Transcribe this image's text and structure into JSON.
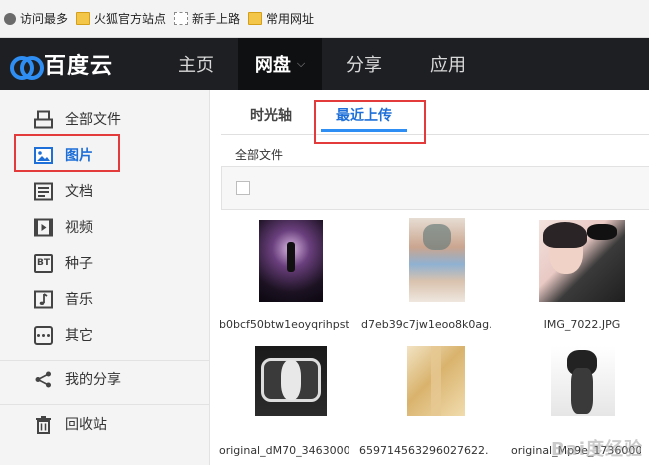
{
  "bookmarks": [
    {
      "label": "访问最多",
      "icon": "gear-icon"
    },
    {
      "label": "火狐官方站点",
      "icon": "folder-icon"
    },
    {
      "label": "新手上路",
      "icon": "page-icon"
    },
    {
      "label": "常用网址",
      "icon": "folder-icon"
    }
  ],
  "app": {
    "name": "百度云"
  },
  "nav": [
    {
      "label": "主页"
    },
    {
      "label": "网盘"
    },
    {
      "label": "分享"
    },
    {
      "label": "应用"
    }
  ],
  "sidebar": {
    "items": [
      {
        "label": "全部文件",
        "icon": "printer-icon"
      },
      {
        "label": "图片",
        "icon": "picture-icon"
      },
      {
        "label": "文档",
        "icon": "document-icon"
      },
      {
        "label": "视频",
        "icon": "video-icon"
      },
      {
        "label": "种子",
        "icon": "bt-icon"
      },
      {
        "label": "音乐",
        "icon": "music-icon"
      },
      {
        "label": "其它",
        "icon": "more-icon"
      },
      {
        "label": "我的分享",
        "icon": "share-icon"
      },
      {
        "label": "回收站",
        "icon": "trash-icon"
      }
    ],
    "active_index": 1
  },
  "main": {
    "tabs": [
      {
        "label": "时光轴"
      },
      {
        "label": "最近上传"
      }
    ],
    "active_tab": 1,
    "breadcrumb": "全部文件",
    "files": [
      {
        "name": "b0bcf50btw1eoyqrihpst..."
      },
      {
        "name": "d7eb39c7jw1eoo8k0ag..."
      },
      {
        "name": "IMG_7022.JPG"
      },
      {
        "name": "original_dM70_3463000..."
      },
      {
        "name": "659714563296027622..."
      },
      {
        "name": "original_Mp9e_1736000..."
      }
    ]
  },
  "watermark": "Bai度经验",
  "colors": {
    "accent": "#2e8ef3",
    "highlight": "#e33b3b",
    "nav_bg": "#1e1f23"
  }
}
